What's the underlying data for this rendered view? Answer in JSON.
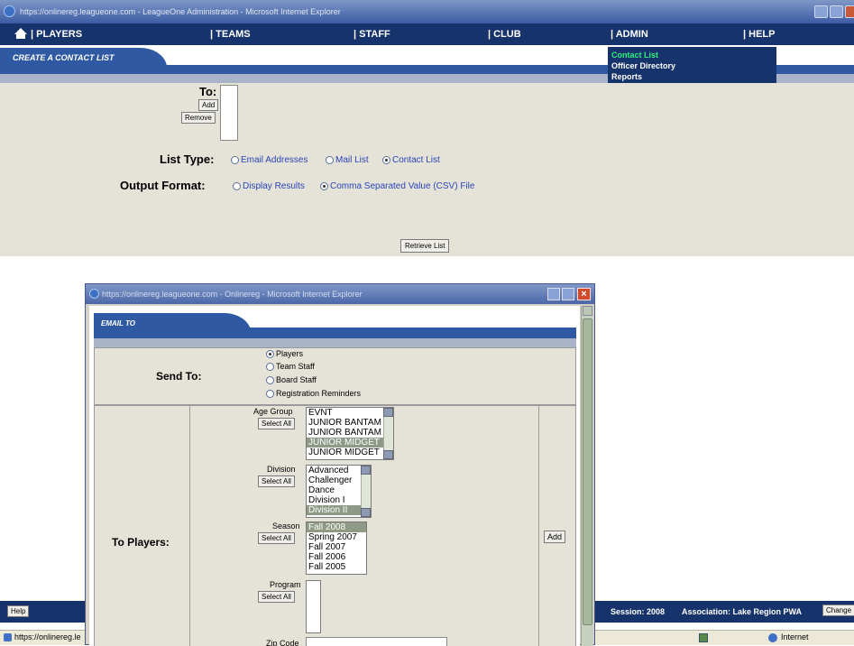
{
  "browser": {
    "title": "https://onlinereg.leagueone.com - LeagueOne Administration - Microsoft Internet Explorer",
    "status_url": "https://onlinereg.le",
    "status_zone": "Internet"
  },
  "nav": {
    "items": [
      "| PLAYERS",
      "| TEAMS",
      "| STAFF",
      "| CLUB",
      "| ADMIN",
      "| HELP"
    ]
  },
  "admin_menu": {
    "items": [
      "Contact List",
      "Officer Directory",
      "Reports"
    ],
    "selected": "Contact List"
  },
  "page": {
    "title": "CREATE A CONTACT LIST",
    "to_label": "To:",
    "add_label": "Add",
    "remove_label": "Remove",
    "list_type_label": "List Type:",
    "list_type_options": [
      "Email Addresses",
      "Mail List",
      "Contact List"
    ],
    "list_type_selected": "Contact List",
    "output_format_label": "Output Format:",
    "output_format_options": [
      "Display Results",
      "Comma Separated Value (CSV) File"
    ],
    "output_format_selected": "Comma Separated Value (CSV) File",
    "retrieve_label": "Retrieve List"
  },
  "footer": {
    "help_label": "Help",
    "session": "Session: 2008",
    "association": "Association: Lake Region PWA",
    "change_label": "Change"
  },
  "popup": {
    "title": "https://onlinereg.leagueone.com - Onlinereg - Microsoft Internet Explorer",
    "header": "EMAIL TO",
    "send_to_label": "Send To:",
    "send_to_options": [
      "Players",
      "Team Staff",
      "Board Staff",
      "Registration Reminders"
    ],
    "send_to_selected": "Players",
    "to_players_label": "To Players:",
    "select_all": "Select All",
    "add_label": "Add",
    "age_group_label": "Age Group",
    "age_group_options": [
      "EVNT",
      "JUNIOR BANTAM",
      "JUNIOR BANTAM",
      "JUNIOR MIDGET",
      "JUNIOR MIDGET"
    ],
    "division_label": "Division",
    "division_options": [
      "Advanced",
      "Challenger",
      "Dance",
      "Division I",
      "Division II"
    ],
    "season_label": "Season",
    "season_options": [
      "Fall 2008",
      "Spring 2007",
      "Fall 2007",
      "Fall 2006",
      "Fall 2005"
    ],
    "program_label": "Program",
    "zip_label": "Zip Code"
  }
}
